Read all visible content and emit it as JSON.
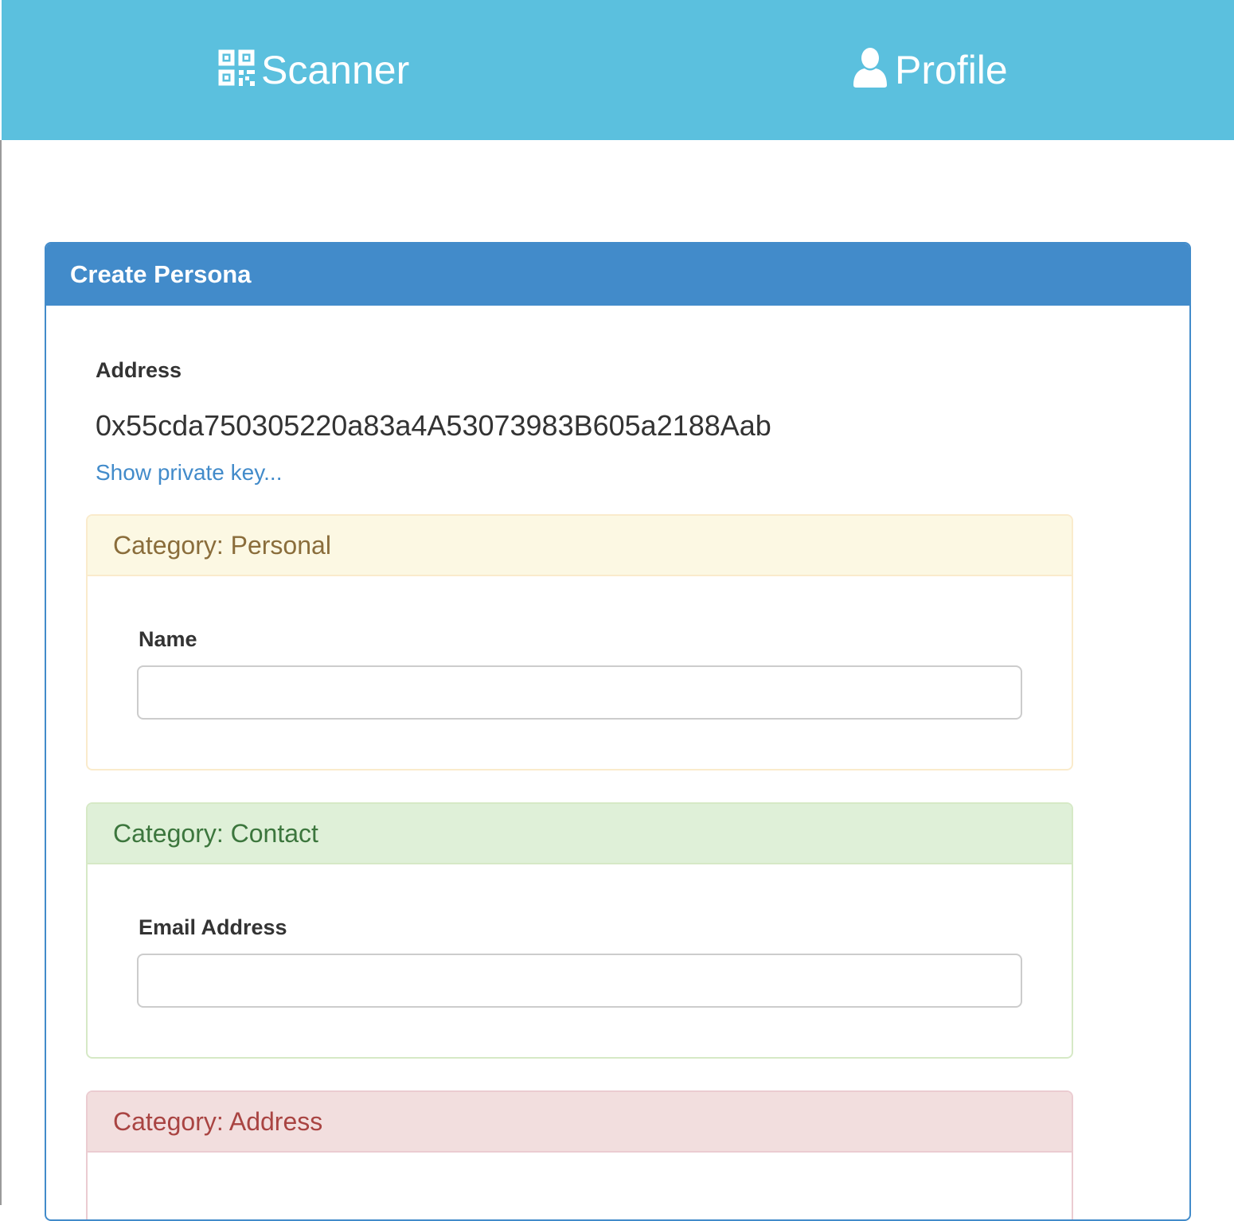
{
  "nav": {
    "scanner": {
      "label": "Scanner",
      "icon": "qrcode-icon"
    },
    "profile": {
      "label": "Profile",
      "icon": "user-icon"
    }
  },
  "panel": {
    "title": "Create Persona",
    "address_label": "Address",
    "address_value": "0x55cda750305220a83a4A53073983B605a2188Aab",
    "private_key_link": "Show private key..."
  },
  "categories": [
    {
      "title": "Category: Personal",
      "field_label": "Name",
      "field_value": ""
    },
    {
      "title": "Category: Contact",
      "field_label": "Email Address",
      "field_value": ""
    },
    {
      "title": "Category: Address"
    }
  ],
  "colors": {
    "navbar": "#5bc0de",
    "primary": "#428bca",
    "personal_bg": "#fcf8e3",
    "personal_text": "#8a6d3b",
    "contact_bg": "#dff0d8",
    "contact_text": "#3c763d",
    "address_bg": "#f2dede",
    "address_text": "#a94442"
  }
}
